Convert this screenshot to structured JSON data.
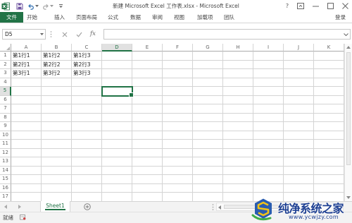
{
  "app": {
    "title": "新建 Microsoft Excel 工作表.xlsx - Microsoft Excel",
    "help_label": "?",
    "icons": {
      "app": "excel-app-icon",
      "save": "save-icon",
      "undo": "undo-icon",
      "redo": "redo-icon",
      "customize": "customize-quick-access-icon",
      "ribbon_options": "ribbon-display-options-icon",
      "minimize": "minimize-icon",
      "maximize": "maximize-icon",
      "close": "close-icon"
    }
  },
  "ribbon": {
    "file_tab": "文件",
    "tabs": [
      "开始",
      "插入",
      "页面布局",
      "公式",
      "数据",
      "审阅",
      "视图",
      "加载项",
      "团队"
    ],
    "sign_in": "登录"
  },
  "formula_bar": {
    "name_box": "D5",
    "fx_label": "fx",
    "value": "",
    "icons": {
      "name_box_dropdown": "chevron-down-icon",
      "cancel": "cancel-icon",
      "enter": "check-icon",
      "expand": "expand-formula-bar-icon"
    }
  },
  "grid": {
    "columns": [
      "A",
      "B",
      "C",
      "D",
      "E",
      "F",
      "G",
      "H",
      "I",
      "J",
      "K"
    ],
    "rows": [
      "1",
      "2",
      "3",
      "4",
      "5",
      "6",
      "7",
      "8",
      "9",
      "10",
      "11",
      "12",
      "13",
      "14",
      "15",
      "16",
      "17"
    ],
    "cells": {
      "A1": "第1行1",
      "B1": "第1行2",
      "C1": "第1行3",
      "A2": "第2行1",
      "B2": "第2行2",
      "C2": "第2行3",
      "A3": "第3行1",
      "B3": "第3行2",
      "C3": "第3行3"
    }
  },
  "sheet_bar": {
    "tabs": [
      "Sheet1"
    ],
    "icons": {
      "prev": "scroll-sheets-left-icon",
      "next": "scroll-sheets-right-icon",
      "add": "add-sheet-icon"
    }
  },
  "status_bar": {
    "status": "就绪",
    "icons": {
      "macro": "macro-record-icon"
    }
  },
  "watermark": {
    "name": "纯净系统之家",
    "url": "www.ycwjzy.com"
  },
  "colors": {
    "accent": "#217346",
    "gridline": "#d4d4d4",
    "header_selected_bg": "#e1e1e1",
    "watermark_text": "#1d3f92"
  }
}
